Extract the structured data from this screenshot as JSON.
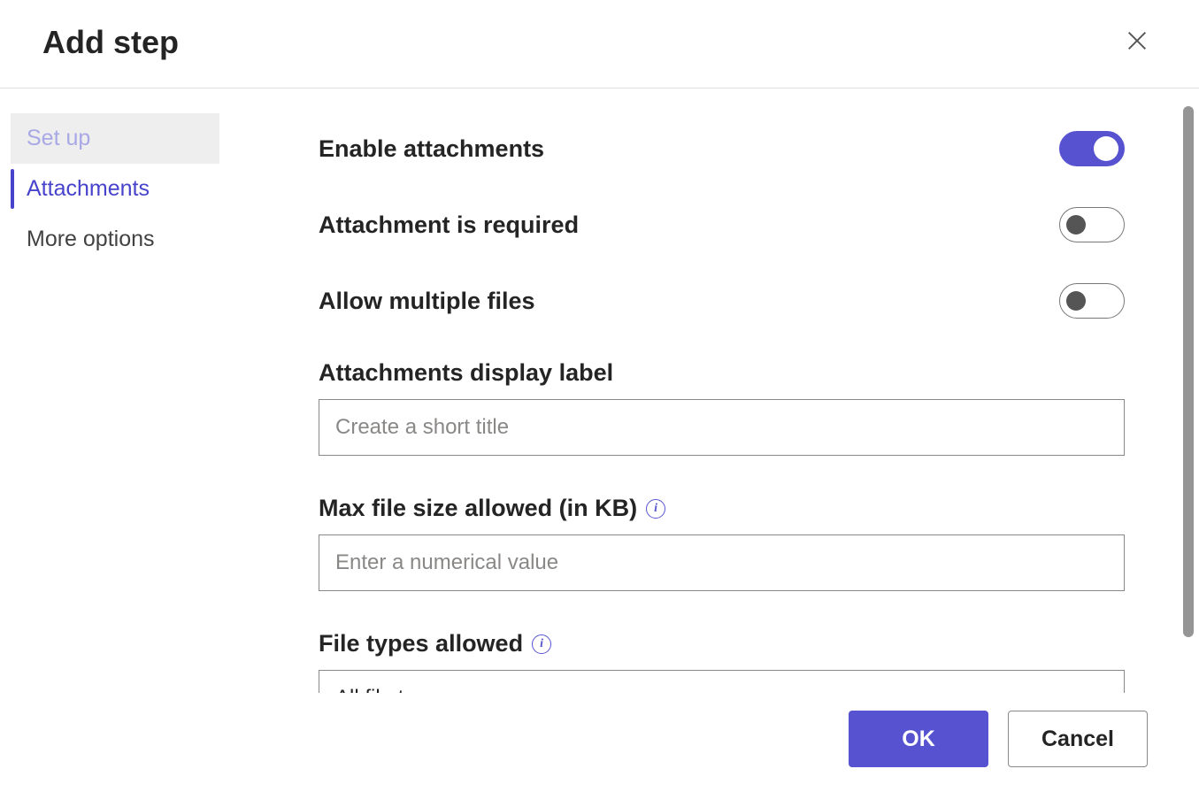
{
  "dialog": {
    "title": "Add step"
  },
  "sidebar": {
    "items": [
      {
        "label": "Set up",
        "state": "visited"
      },
      {
        "label": "Attachments",
        "state": "active"
      },
      {
        "label": "More options",
        "state": "normal"
      }
    ]
  },
  "form": {
    "enable_attachments": {
      "label": "Enable attachments",
      "value": true
    },
    "attachment_required": {
      "label": "Attachment is required",
      "value": false
    },
    "allow_multiple": {
      "label": "Allow multiple files",
      "value": false
    },
    "display_label": {
      "label": "Attachments display label",
      "placeholder": "Create a short title",
      "value": ""
    },
    "max_size": {
      "label": "Max file size allowed (in KB)",
      "placeholder": "Enter a numerical value",
      "value": ""
    },
    "file_types": {
      "label": "File types allowed",
      "selected": "All file types"
    }
  },
  "footer": {
    "ok": "OK",
    "cancel": "Cancel"
  }
}
